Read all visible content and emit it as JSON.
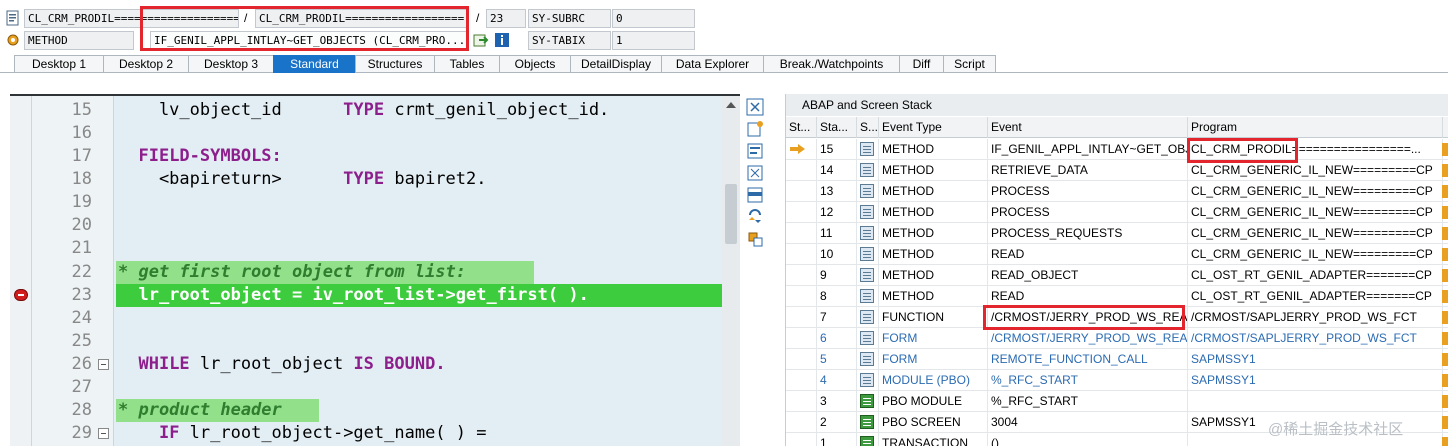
{
  "top": {
    "row1": {
      "program_short": "CL_CRM_PRODIL===",
      "program_full_1": "=================...",
      "slash": "/",
      "program_full_2": "CL_CRM_PRODIL==================...",
      "slash2": "/",
      "line_no": "23",
      "sysvar_name": "SY-SUBRC",
      "sysvar_value": "0"
    },
    "row2": {
      "event_type": "METHOD",
      "event_name": "IF_GENIL_APPL_INTLAY~GET_OBJECTS (CL_CRM_PRO...",
      "sysvar_name": "SY-TABIX",
      "sysvar_value": "1"
    }
  },
  "tabs": [
    "Desktop 1",
    "Desktop 2",
    "Desktop 3",
    "Standard",
    "Structures",
    "Tables",
    "Objects",
    "DetailDisplay",
    "Data Explorer",
    "Break./Watchpoints",
    "Diff",
    "Script"
  ],
  "active_tab": "Standard",
  "editor": {
    "lines": [
      {
        "n": "15"
      },
      {
        "n": "16"
      },
      {
        "n": "17"
      },
      {
        "n": "18"
      },
      {
        "n": "19"
      },
      {
        "n": "20"
      },
      {
        "n": "21"
      },
      {
        "n": "22"
      },
      {
        "n": "23"
      },
      {
        "n": "24"
      },
      {
        "n": "25"
      },
      {
        "n": "26"
      },
      {
        "n": "27"
      },
      {
        "n": "28"
      },
      {
        "n": "29"
      }
    ],
    "l15_a": "    lv_object_id      ",
    "l15_kw": "TYPE",
    "l15_b": " crmt_genil_object_id.",
    "l17_kw1": "FIELD-SYMBOLS:",
    "l18_a": "    <bapireturn>      ",
    "l18_kw": "TYPE",
    "l18_b": " bapiret2.",
    "l22_cm": "* get first root object from list:",
    "l23": "  lr_root_object = iv_root_list->get_first( ).",
    "l26_kw": "WHILE",
    "l26_a": " lr_root_object ",
    "l26_kw2": "IS BOUND.",
    "l28_cm": "* product header",
    "l29_kw": "IF",
    "l29_a": " lr_root_object->get_name( ) ="
  },
  "stack": {
    "title": "ABAP and Screen Stack",
    "headers": [
      "St...",
      "Sta...",
      "S...",
      "Event Type",
      "Event",
      "Program"
    ],
    "rows": [
      {
        "level": "15",
        "type": "METHOD",
        "event": "IF_GENIL_APPL_INTLAY~GET_OBJ...",
        "program": "CL_CRM_PRODIL=================...",
        "current": true,
        "blue": false,
        "icon": "method"
      },
      {
        "level": "14",
        "type": "METHOD",
        "event": "RETRIEVE_DATA",
        "program": "CL_CRM_GENERIC_IL_NEW=========CP",
        "blue": false,
        "icon": "method"
      },
      {
        "level": "13",
        "type": "METHOD",
        "event": "PROCESS",
        "program": "CL_CRM_GENERIC_IL_NEW=========CP",
        "blue": false,
        "icon": "method"
      },
      {
        "level": "12",
        "type": "METHOD",
        "event": "PROCESS",
        "program": "CL_CRM_GENERIC_IL_NEW=========CP",
        "blue": false,
        "icon": "method"
      },
      {
        "level": "11",
        "type": "METHOD",
        "event": "PROCESS_REQUESTS",
        "program": "CL_CRM_GENERIC_IL_NEW=========CP",
        "blue": false,
        "icon": "method"
      },
      {
        "level": "10",
        "type": "METHOD",
        "event": "READ",
        "program": "CL_CRM_GENERIC_IL_NEW=========CP",
        "blue": false,
        "icon": "method"
      },
      {
        "level": "9",
        "type": "METHOD",
        "event": "READ_OBJECT",
        "program": "CL_OST_RT_GENIL_ADAPTER=======CP",
        "blue": false,
        "icon": "method"
      },
      {
        "level": "8",
        "type": "METHOD",
        "event": "READ",
        "program": "CL_OST_RT_GENIL_ADAPTER=======CP",
        "blue": false,
        "icon": "method"
      },
      {
        "level": "7",
        "type": "FUNCTION",
        "event": "/CRMOST/JERRY_PROD_WS_READ",
        "program": "/CRMOST/SAPLJERRY_PROD_WS_FCT",
        "blue": false,
        "icon": "method"
      },
      {
        "level": "6",
        "type": "FORM",
        "event": "/CRMOST/JERRY_PROD_WS_READ",
        "program": "/CRMOST/SAPLJERRY_PROD_WS_FCT",
        "blue": true,
        "icon": "method"
      },
      {
        "level": "5",
        "type": "FORM",
        "event": "REMOTE_FUNCTION_CALL",
        "program": "SAPMSSY1",
        "blue": true,
        "icon": "method"
      },
      {
        "level": "4",
        "type": "MODULE (PBO)",
        "event": "%_RFC_START",
        "program": "SAPMSSY1",
        "blue": true,
        "icon": "method"
      },
      {
        "level": "3",
        "type": "PBO MODULE",
        "event": "%_RFC_START",
        "program": "",
        "blue": false,
        "icon": "pbo"
      },
      {
        "level": "2",
        "type": "PBO SCREEN",
        "event": "3004",
        "program": "SAPMSSY1",
        "blue": false,
        "icon": "pbo"
      },
      {
        "level": "1",
        "type": "TRANSACTION",
        "event": "()",
        "program": "",
        "blue": false,
        "icon": "pbo"
      }
    ]
  },
  "watermark": "@稀土掘金技术社区",
  "colors": {
    "active_tab": "#1973c8",
    "current_line": "#3dcc3d",
    "comment_bg": "#92e08a",
    "keyword": "#8d1f8d",
    "highlight_box": "#e3262d"
  }
}
